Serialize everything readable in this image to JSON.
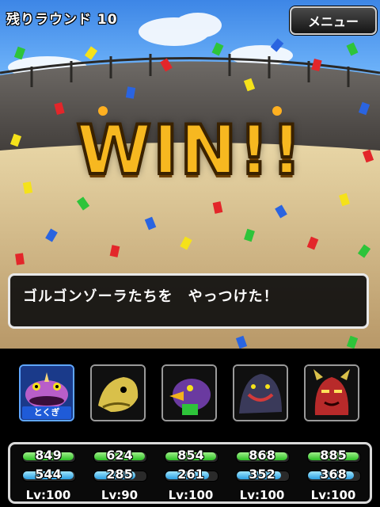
{
  "header": {
    "rounds_label": "残りラウンド 10",
    "menu_label": "メニュー"
  },
  "victory": {
    "banner": "WIN!!"
  },
  "message": {
    "text": "ゴルゴンゾーラたちを　やっつけた！"
  },
  "party": [
    {
      "portrait_icon": "purple-frog-monster-icon",
      "selected": true,
      "skill_tag": "とくぎ",
      "hp": 849,
      "hp_fraction": 1.0,
      "mp": 544,
      "mp_fraction": 1.0,
      "level": "Lv:100"
    },
    {
      "portrait_icon": "yellow-dragon-monster-icon",
      "selected": false,
      "skill_tag": "",
      "hp": 624,
      "hp_fraction": 1.0,
      "mp": 285,
      "mp_fraction": 0.82,
      "level": "Lv:90"
    },
    {
      "portrait_icon": "purple-bird-monster-icon",
      "selected": false,
      "skill_tag": "",
      "hp": 854,
      "hp_fraction": 1.0,
      "mp": 261,
      "mp_fraction": 0.86,
      "level": "Lv:100"
    },
    {
      "portrait_icon": "dark-beast-monster-icon",
      "selected": false,
      "skill_tag": "",
      "hp": 868,
      "hp_fraction": 1.0,
      "mp": 352,
      "mp_fraction": 0.88,
      "level": "Lv:100"
    },
    {
      "portrait_icon": "red-demon-monster-icon",
      "selected": false,
      "skill_tag": "",
      "hp": 885,
      "hp_fraction": 1.0,
      "mp": 368,
      "mp_fraction": 0.9,
      "level": "Lv:100"
    }
  ],
  "colors": {
    "win_gold": "#f7b820",
    "hp_green": "#2bc023",
    "mp_blue": "#2a9ee0",
    "selected_blue": "#1f5bd8"
  }
}
